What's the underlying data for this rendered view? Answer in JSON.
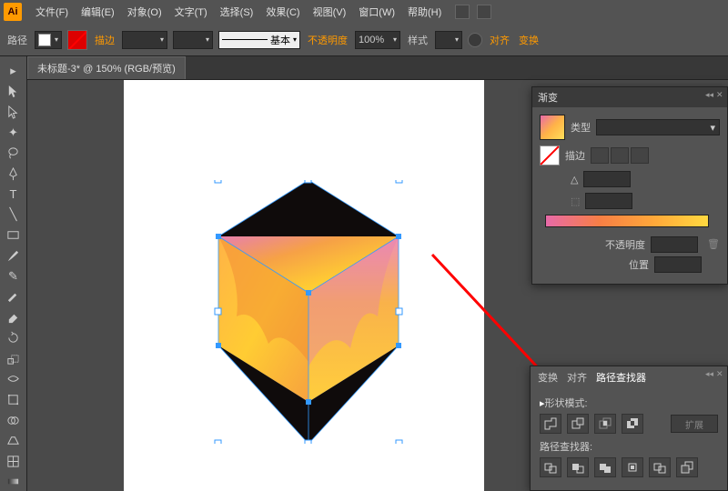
{
  "app": {
    "icon_label": "Ai"
  },
  "menu": {
    "file": "文件(F)",
    "edit": "编辑(E)",
    "object": "对象(O)",
    "type": "文字(T)",
    "select": "选择(S)",
    "effect": "效果(C)",
    "view": "视图(V)",
    "window": "窗口(W)",
    "help": "帮助(H)"
  },
  "control": {
    "path_label": "路径",
    "stroke_label": "描边",
    "stroke_weight": "",
    "stroke_style_label": "基本",
    "opacity_label": "不透明度",
    "opacity_value": "100%",
    "style_label": "样式",
    "align_label": "对齐",
    "transform_label": "变换"
  },
  "document": {
    "tab_title": "未标题-3* @ 150% (RGB/预览)"
  },
  "gradient_panel": {
    "title": "渐变",
    "type_label": "类型",
    "stroke_label": "描边",
    "angle_label": "",
    "opacity_label": "不透明度",
    "location_label": "位置"
  },
  "pathfinder_panel": {
    "tabs": {
      "transform": "变换",
      "align": "对齐",
      "pathfinder": "路径查找器"
    },
    "shape_mode_label": "形状模式",
    "expand_label": "扩展",
    "pathfinder_label": "路径查找器"
  }
}
